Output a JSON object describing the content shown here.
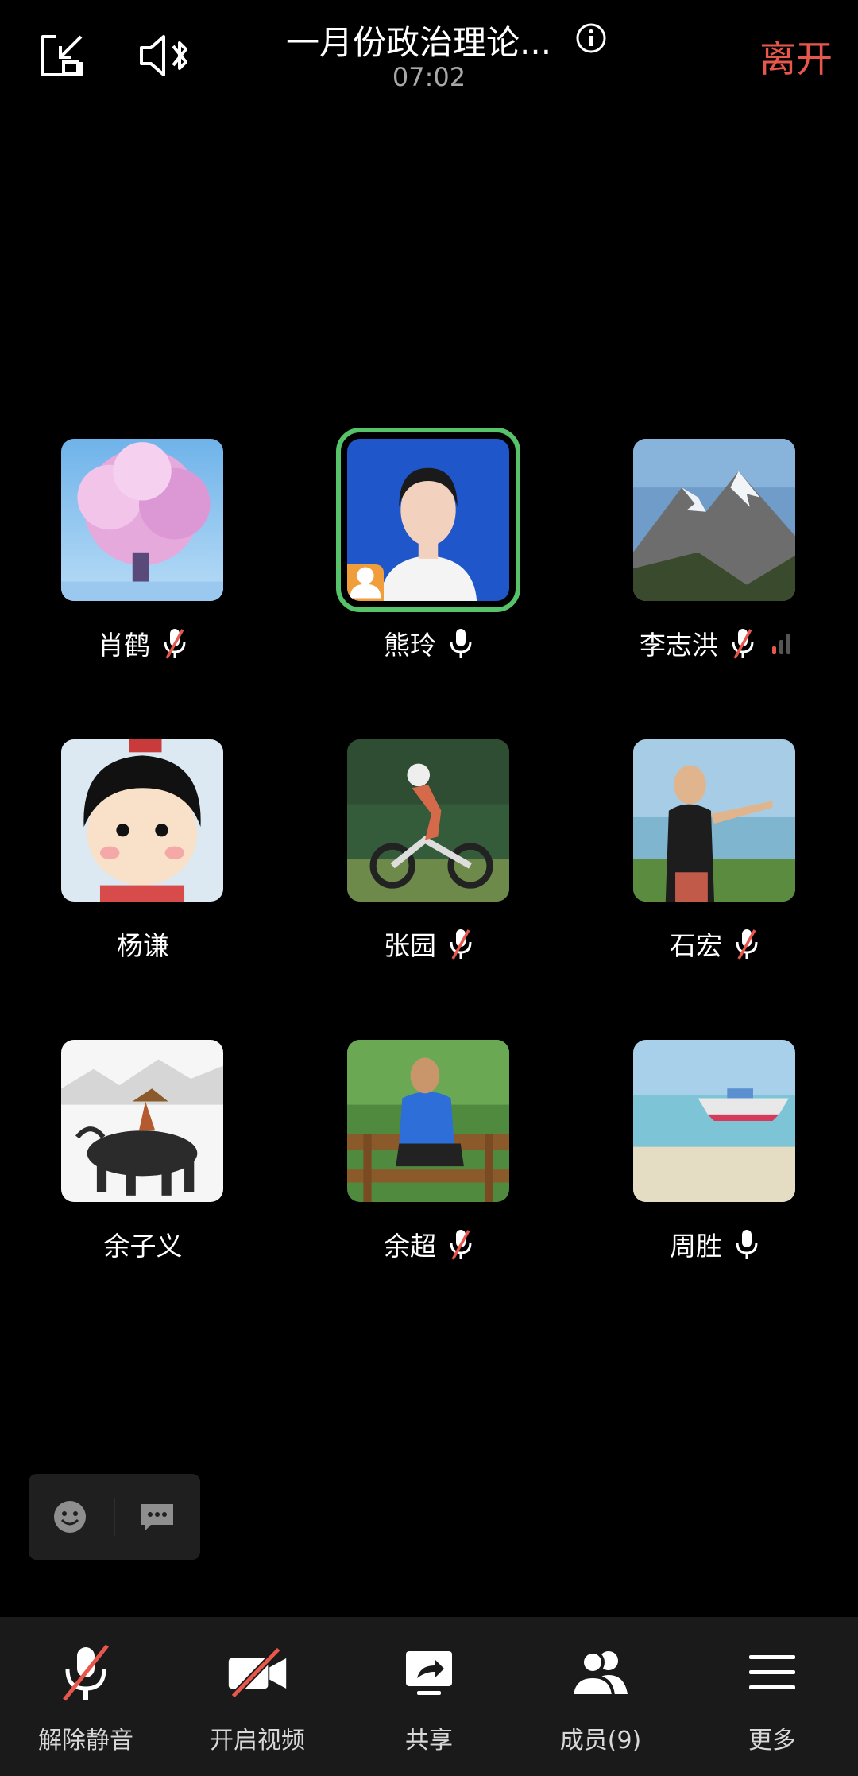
{
  "header": {
    "title": "一月份政治理论...",
    "time": "07:02",
    "leave_label": "离开"
  },
  "participants": [
    {
      "name": "肖鹤",
      "mic": "muted",
      "avatar": "cherry-blossom-tree"
    },
    {
      "name": "熊玲",
      "mic": "on",
      "avatar": "woman-portrait-blue",
      "host": true,
      "speaking": true
    },
    {
      "name": "李志洪",
      "mic": "muted",
      "avatar": "snowy-mountains",
      "signal": "weak"
    },
    {
      "name": "杨谦",
      "mic": "none",
      "avatar": "cartoon-girl"
    },
    {
      "name": "张园",
      "mic": "muted",
      "avatar": "motocross-rider"
    },
    {
      "name": "石宏",
      "mic": "muted",
      "avatar": "man-on-beach"
    },
    {
      "name": "余子义",
      "mic": "none",
      "avatar": "ink-painting-ox"
    },
    {
      "name": "余超",
      "mic": "muted",
      "avatar": "man-on-bench"
    },
    {
      "name": "周胜",
      "mic": "on",
      "avatar": "speedboat-sea"
    }
  ],
  "toolbar": {
    "unmute_label": "解除静音",
    "video_label": "开启视频",
    "share_label": "共享",
    "members_label": "成员(9)",
    "more_label": "更多"
  },
  "colors": {
    "accent_leave": "#e8574b",
    "speaking_border": "#56c26a",
    "host_badge": "#f09d3b",
    "muted_slash": "#e8574b"
  }
}
